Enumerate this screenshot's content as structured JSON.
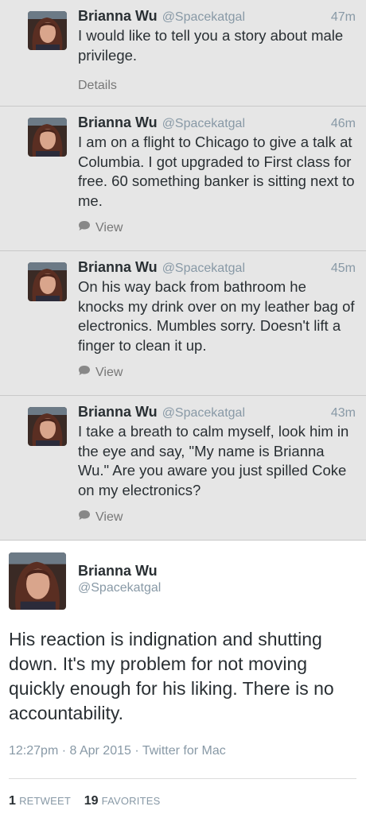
{
  "timeline": [
    {
      "name": "Brianna Wu",
      "handle": "@Spacekatgal",
      "time": "47m",
      "text": "I would like to tell you a story about male privilege.",
      "action": "Details"
    },
    {
      "name": "Brianna Wu",
      "handle": "@Spacekatgal",
      "time": "46m",
      "text": "I am on a flight to Chicago to give a talk at Columbia. I got upgraded to First class for free. 60 something banker is sitting next to me.",
      "action": "View"
    },
    {
      "name": "Brianna Wu",
      "handle": "@Spacekatgal",
      "time": "45m",
      "text": "On his way back from bathroom he knocks my drink over on my leather bag of electronics. Mumbles sorry. Doesn't lift a finger to clean it up.",
      "action": "View"
    },
    {
      "name": "Brianna Wu",
      "handle": "@Spacekatgal",
      "time": "43m",
      "text": "I take a breath to calm myself, look him in the eye and say, \"My name is Brianna Wu.\" Are you aware you just spilled Coke on my electronics?",
      "action": "View"
    }
  ],
  "focused": {
    "name": "Brianna Wu",
    "handle": "@Spacekatgal",
    "text": "His reaction is indignation and shutting down. It's my problem for not moving quickly enough for his liking. There is no accountability.",
    "time": "12:27pm",
    "date": "8 Apr 2015",
    "client": "Twitter for Mac",
    "separator": "·",
    "retweets_count": "1",
    "retweets_label": "RETWEET",
    "favorites_count": "19",
    "favorites_label": "FAVORITES"
  },
  "icons": {
    "action": "speech-bubble-icon",
    "avatar": "profile-photo"
  },
  "colors": {
    "timeline_bg": "#e6e6e6",
    "focused_bg": "#ffffff",
    "muted": "#8899a6"
  }
}
